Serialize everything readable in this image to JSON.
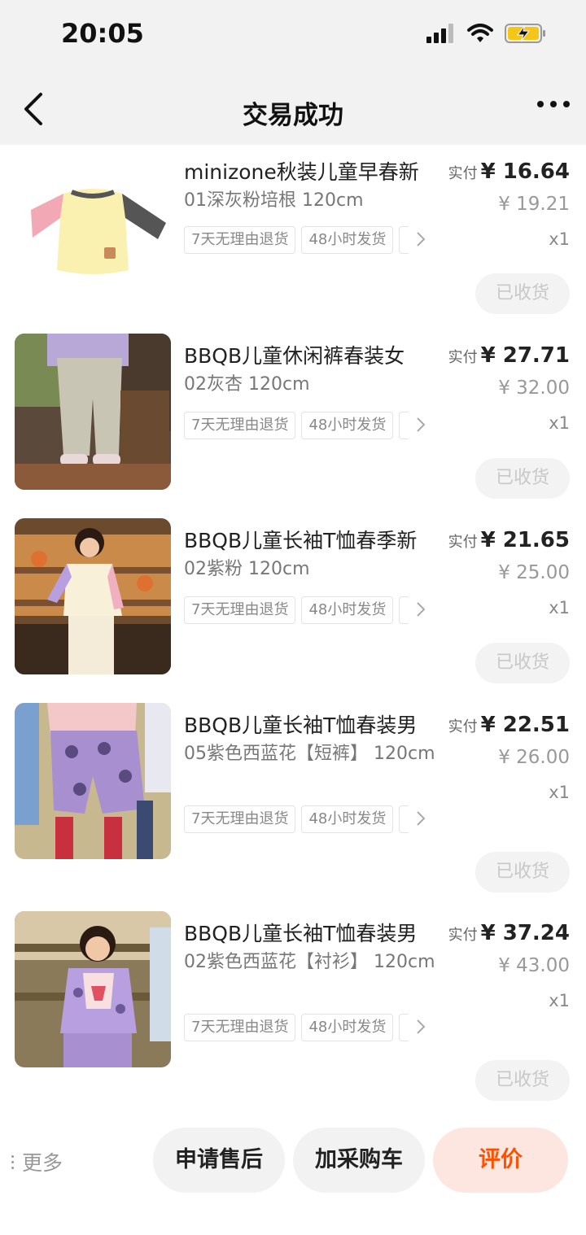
{
  "status": {
    "time": "20:05"
  },
  "nav": {
    "title": "交易成功"
  },
  "items": [
    {
      "title": "minizone秋装儿童早春新",
      "sku": "01深灰粉培根 120cm",
      "tags": [
        "7天无理由退货",
        "48小时发货"
      ],
      "paid_label": "实付",
      "paid_price": "¥ 16.64",
      "orig_price": "¥ 19.21",
      "qty": "x1",
      "status_btn": "已收货"
    },
    {
      "title": "BBQB儿童休闲裤春装女",
      "sku": "02灰杏 120cm",
      "tags": [
        "7天无理由退货",
        "48小时发货"
      ],
      "paid_label": "实付",
      "paid_price": "¥ 27.71",
      "orig_price": "¥ 32.00",
      "qty": "x1",
      "status_btn": "已收货"
    },
    {
      "title": "BBQB儿童长袖T恤春季新",
      "sku": "02紫粉 120cm",
      "tags": [
        "7天无理由退货",
        "48小时发货"
      ],
      "paid_label": "实付",
      "paid_price": "¥ 21.65",
      "orig_price": "¥ 25.00",
      "qty": "x1",
      "status_btn": "已收货"
    },
    {
      "title": "BBQB儿童长袖T恤春装男",
      "sku": "05紫色西蓝花【短裤】 120cm",
      "tags": [
        "7天无理由退货",
        "48小时发货"
      ],
      "paid_label": "实付",
      "paid_price": "¥ 22.51",
      "orig_price": "¥ 26.00",
      "qty": "x1",
      "status_btn": "已收货"
    },
    {
      "title": "BBQB儿童长袖T恤春装男",
      "sku": "02紫色西蓝花【衬衫】 120cm",
      "tags": [
        "7天无理由退货",
        "48小时发货"
      ],
      "paid_label": "实付",
      "paid_price": "¥ 37.24",
      "orig_price": "¥ 43.00",
      "qty": "x1",
      "status_btn": "已收货"
    }
  ],
  "bottom": {
    "more": "更多",
    "after_sale": "申请售后",
    "add_cart": "加采购车",
    "review": "评价"
  },
  "colors": {
    "accent": "#ff5000",
    "accent_bg": "#fde6df"
  },
  "icons": [
    "back-arrow-icon",
    "more-dots-icon",
    "signal-icon",
    "wifi-icon",
    "battery-charging-icon",
    "chevron-right-icon"
  ]
}
